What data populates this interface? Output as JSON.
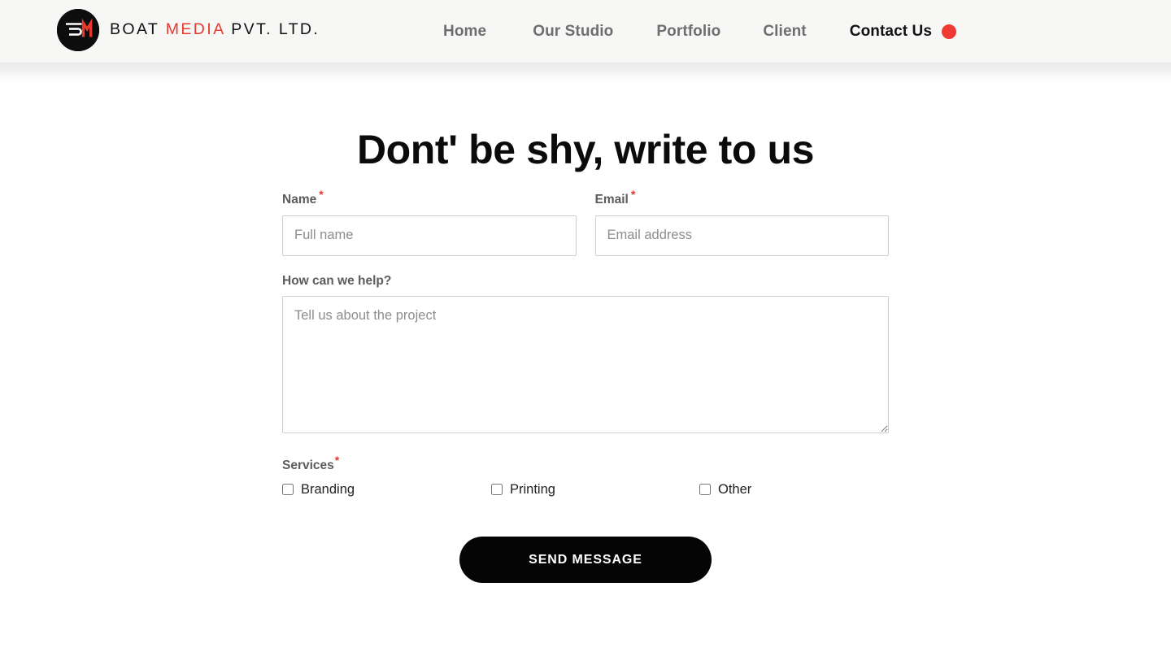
{
  "header": {
    "logo": {
      "mark_icon": "bm-monogram-icon",
      "mark_bg_color": "#0d0d0d",
      "accent_color": "#e8392e",
      "text_part_1": "BOAT ",
      "text_accent": "MEDIA",
      "text_part_2": " PVT. LTD.",
      "full_text": "BOAT MEDIA PVT. LTD."
    },
    "nav": {
      "items": [
        {
          "label": "Home",
          "active": false
        },
        {
          "label": "Our Studio",
          "active": false
        },
        {
          "label": "Portfolio",
          "active": false
        },
        {
          "label": "Client",
          "active": false
        },
        {
          "label": "Contact Us",
          "active": true
        }
      ],
      "active_indicator_icon": "red-dot-icon",
      "active_indicator_color": "#ef3a34",
      "inactive_color": "#6e6e6e",
      "active_color": "#111111"
    },
    "background_color": "#f7f7f6"
  },
  "main": {
    "title": "Dont' be shy, write to us",
    "form": {
      "name": {
        "label": "Name",
        "required_marker": "*",
        "placeholder": "Full name",
        "value": ""
      },
      "email": {
        "label": "Email",
        "required_marker": "*",
        "placeholder": "Email address",
        "value": ""
      },
      "message": {
        "label": "How can we help?",
        "placeholder": "Tell us about the project",
        "value": ""
      },
      "services": {
        "label": "Services",
        "required_marker": "*",
        "options": [
          {
            "label": "Branding",
            "checked": false
          },
          {
            "label": "Printing",
            "checked": false
          },
          {
            "label": "Other",
            "checked": false
          }
        ]
      },
      "submit_label": "SEND MESSAGE",
      "required_color": "#e8362c",
      "label_color": "#5c5c5c",
      "placeholder_color": "#8d8d8d",
      "submit_bg_color": "#050505"
    }
  }
}
